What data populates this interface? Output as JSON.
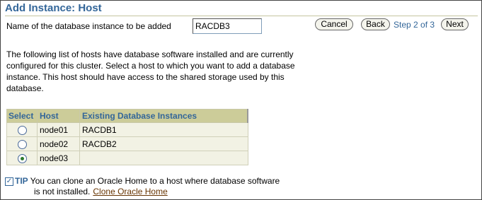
{
  "page": {
    "title": "Add Instance: Host",
    "instance_label": "Name of the database instance to be added",
    "instance_value": "RACDB3"
  },
  "toolbar": {
    "cancel_label": "Cancel",
    "back_label": "Back",
    "step_text": "Step 2 of 3",
    "next_label": "Next"
  },
  "description": "The following list of hosts have database software installed and are currently configured for this cluster. Select a host to which you want to add a database instance. This host should have access to the shared storage used by this database.",
  "hosts_table": {
    "columns": [
      "Select",
      "Host",
      "Existing Database Instances"
    ],
    "rows": [
      {
        "host": "node01",
        "instances": "RACDB1",
        "selected": false
      },
      {
        "host": "node02",
        "instances": "RACDB2",
        "selected": false
      },
      {
        "host": "node03",
        "instances": "",
        "selected": true
      }
    ]
  },
  "tip": {
    "label": "TIP",
    "text_line1": "You can clone an Oracle Home to a host where database software",
    "text_line2": "is not installed.",
    "link": "Clone Oracle Home"
  },
  "colors": {
    "title": "#336699",
    "header_bg": "#cccc99",
    "row_bg": "#f2f2e4",
    "link": "#663300"
  }
}
